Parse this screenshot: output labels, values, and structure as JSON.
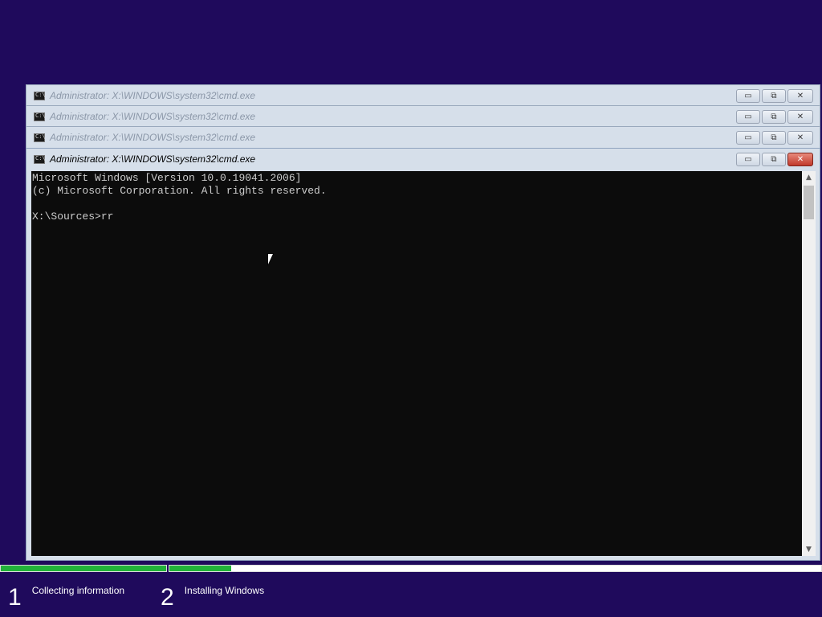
{
  "windows": {
    "back": [
      {
        "title": "Administrator: X:\\WINDOWS\\system32\\cmd.exe"
      },
      {
        "title": "Administrator: X:\\WINDOWS\\system32\\cmd.exe"
      },
      {
        "title": "Administrator: X:\\WINDOWS\\system32\\cmd.exe"
      }
    ],
    "active": {
      "title": "Administrator: X:\\WINDOWS\\system32\\cmd.exe",
      "console_lines": [
        "Microsoft Windows [Version 10.0.19041.2006]",
        "(c) Microsoft Corporation. All rights reserved.",
        "",
        "X:\\Sources>rr"
      ]
    },
    "controls": {
      "minimize": "▭",
      "maximize": "⧉",
      "close": "✕"
    }
  },
  "icons": {
    "app": "cmd-icon",
    "cursor": "mouse-pointer-icon"
  },
  "colors": {
    "background": "#1f0a5c",
    "progress_fill": "#22b33a",
    "close_button": "#c0392b"
  },
  "setup": {
    "steps": [
      {
        "number": "1",
        "label": "Collecting information",
        "progress": 1.0
      },
      {
        "number": "2",
        "label": "Installing Windows",
        "progress": 0.095
      }
    ]
  }
}
